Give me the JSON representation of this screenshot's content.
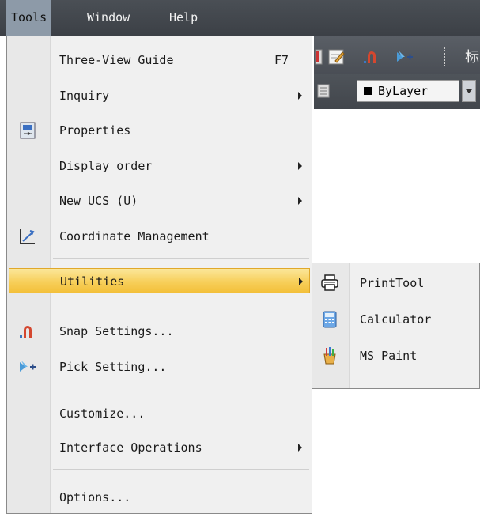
{
  "menubar": {
    "items": [
      {
        "label": "Tools",
        "mnemonic_index": 0
      },
      {
        "label": "Window",
        "mnemonic_index": 0
      },
      {
        "label": "Help",
        "mnemonic_index": 0
      }
    ]
  },
  "toolbar": {
    "layer_value": "ByLayer",
    "cjk_label": "标"
  },
  "tools_menu": {
    "three_view_guide": {
      "label": "Three-View Guide",
      "shortcut": "F7"
    },
    "inquiry": {
      "label": "Inquiry"
    },
    "properties": {
      "label": "Properties"
    },
    "display_order": {
      "label": "Display order"
    },
    "new_ucs": {
      "label": "New UCS (U)"
    },
    "coordinate_management": {
      "label": "Coordinate Management"
    },
    "utilities": {
      "label": "Utilities"
    },
    "snap_settings": {
      "label": "Snap Settings..."
    },
    "pick_setting": {
      "label": "Pick Setting..."
    },
    "customize": {
      "label": "Customize..."
    },
    "interface_operations": {
      "label": "Interface Operations"
    },
    "options": {
      "label": "Options..."
    }
  },
  "utilities_submenu": {
    "print_tool": {
      "label": "PrintTool",
      "icon": "printer-icon"
    },
    "calculator": {
      "label": "Calculator",
      "icon": "calculator-icon"
    },
    "ms_paint": {
      "label": "MS Paint",
      "icon": "paint-icon"
    }
  },
  "colors": {
    "menubar_bg": "#3c4046",
    "menubar_active": "#8d9aa8",
    "highlight": "#f7cf5a",
    "menu_bg": "#f0f0f0"
  }
}
